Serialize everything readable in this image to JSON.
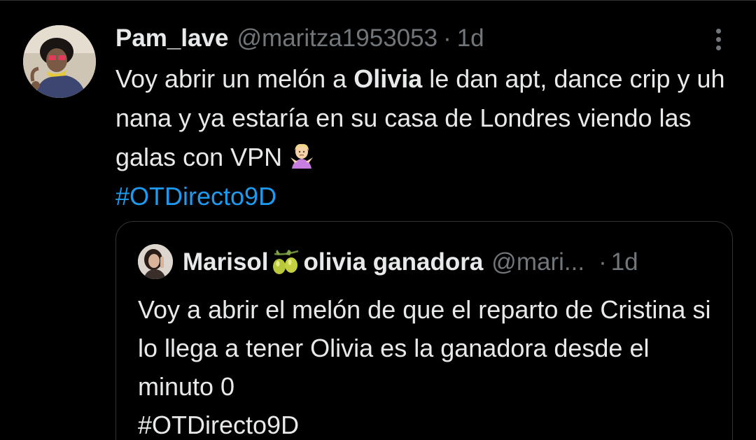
{
  "tweet": {
    "display_name": "Pam_lave",
    "handle": "@maritza1953053",
    "separator": "·",
    "time": "1d",
    "text_part1": "Voy abrir un melón a ",
    "text_bold": "Olivia",
    "text_part2": " le dan apt, dance crip y uh nana y ya estaría en su casa de Londres viendo las galas con VPN",
    "emoji": "person-shrugging-emoji",
    "hashtag": "#OTDirecto9D",
    "more_icon": "more-vertical-icon"
  },
  "quote": {
    "name_part1": "Marisol",
    "name_emoji": "olive-emoji",
    "name_part2": "olivia ganadora",
    "handle": "@mari...",
    "separator": "·",
    "time": "1d",
    "text": "Voy a abrir el melón de que el reparto de Cristina si lo llega a tener Olivia es la ganadora desde el minuto 0",
    "hashtag": "#OTDirecto9D"
  },
  "colors": {
    "background": "#000000",
    "text": "#e7e9ea",
    "secondary": "#71767b",
    "link": "#1d9bf0",
    "border": "#2f3336"
  }
}
